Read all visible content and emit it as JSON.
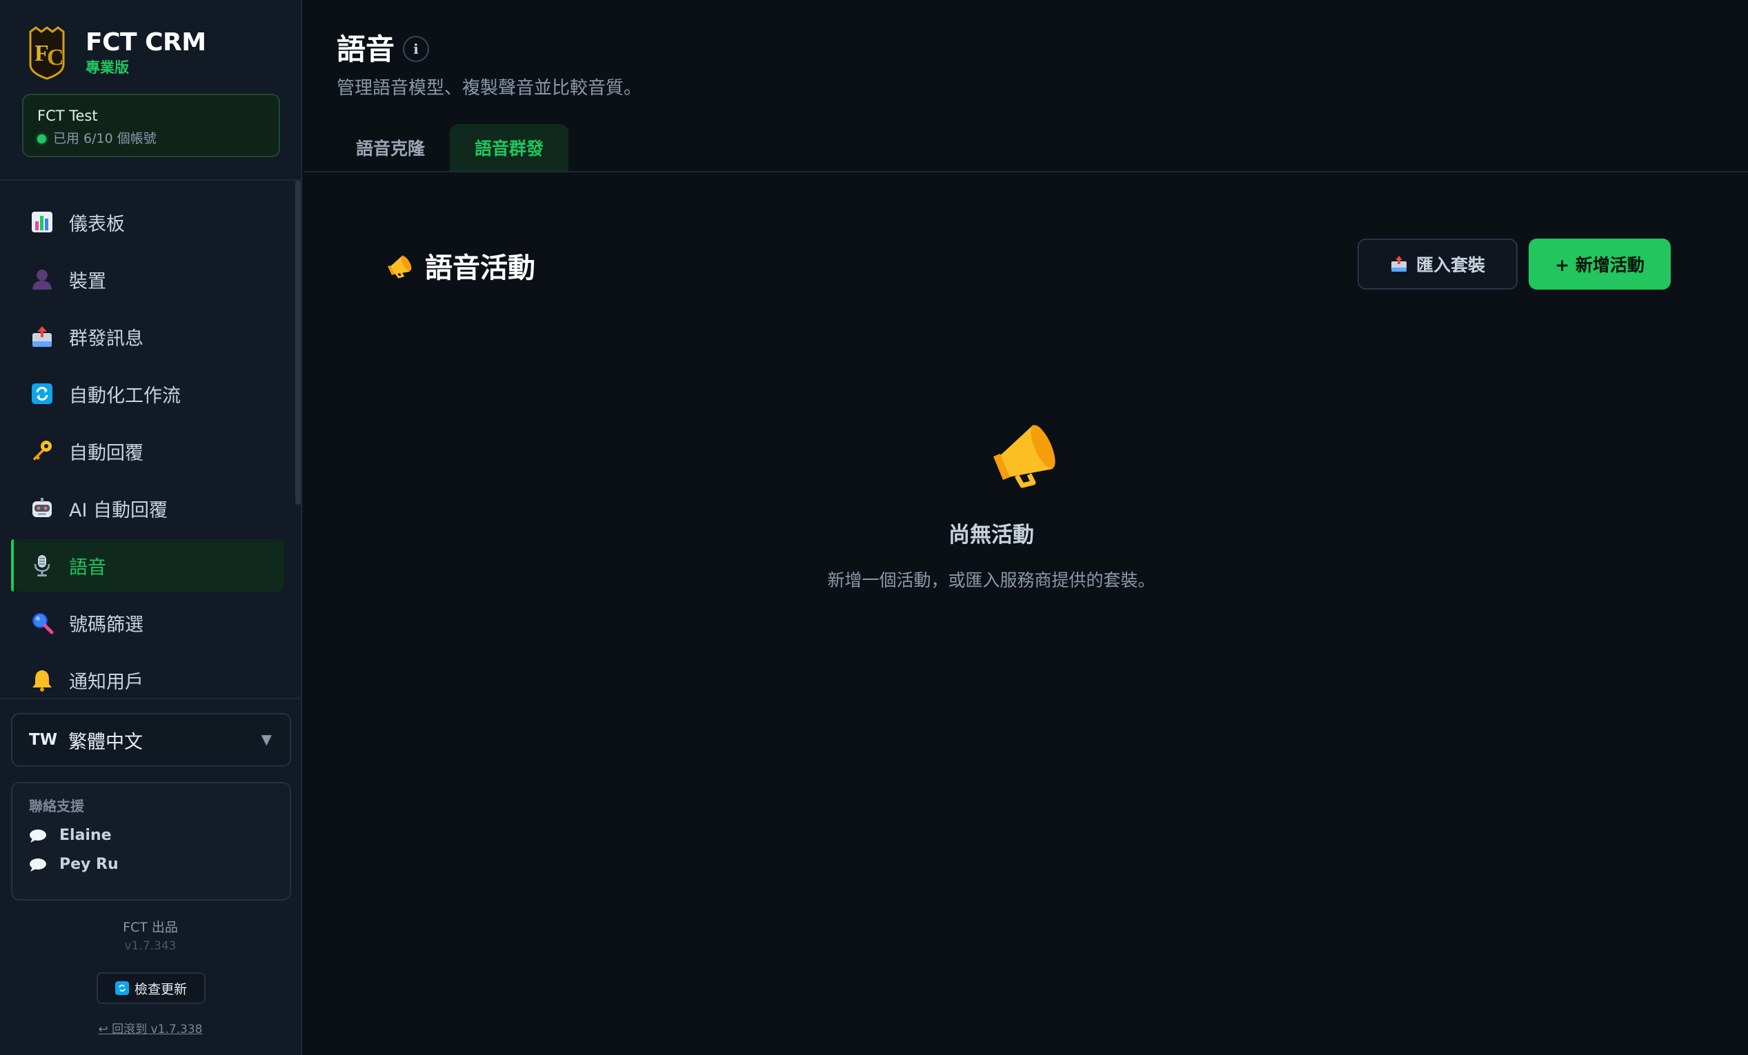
{
  "brand": {
    "title": "FCT CRM",
    "subtitle": "專業版"
  },
  "account": {
    "name": "FCT Test",
    "usage": "已用 6/10 個帳號"
  },
  "nav": {
    "items": [
      {
        "label": "儀表板",
        "icon": "chart-icon"
      },
      {
        "label": "裝置",
        "icon": "person-silhouette-icon"
      },
      {
        "label": "群發訊息",
        "icon": "inbox-tray-icon"
      },
      {
        "label": "自動化工作流",
        "icon": "refresh-icon"
      },
      {
        "label": "自動回覆",
        "icon": "key-icon"
      },
      {
        "label": "AI 自動回覆",
        "icon": "robot-icon"
      },
      {
        "label": "語音",
        "icon": "microphone-icon",
        "active": true
      },
      {
        "label": "號碼篩選",
        "icon": "magnifier-icon"
      },
      {
        "label": "通知用戶",
        "icon": "bell-icon"
      }
    ]
  },
  "language": {
    "flag": "TW",
    "label": "繁體中文"
  },
  "support": {
    "title": "聯絡支援",
    "contacts": [
      "Elaine",
      "Pey Ru"
    ]
  },
  "footer": {
    "made_by": "FCT 出品",
    "version": "v1.7.343",
    "update_label": "檢查更新",
    "rollback_label": "↩ 回滾到 v1.7.338"
  },
  "page": {
    "title": "語音",
    "info_glyph": "i",
    "subtitle": "管理語音模型、複製聲音並比較音質。",
    "tabs": [
      {
        "label": "語音克隆",
        "active": false
      },
      {
        "label": "語音群發",
        "active": true
      }
    ]
  },
  "section": {
    "title": "語音活動",
    "import_label": "匯入套裝",
    "new_label": "+ 新增活動"
  },
  "empty": {
    "title": "尚無活動",
    "description": "新增一個活動，或匯入服務商提供的套裝。"
  },
  "colors": {
    "accent": "#22c55e",
    "background": "#0b1017",
    "sidebar": "#111a25",
    "megaphone": "#fbbf24"
  }
}
